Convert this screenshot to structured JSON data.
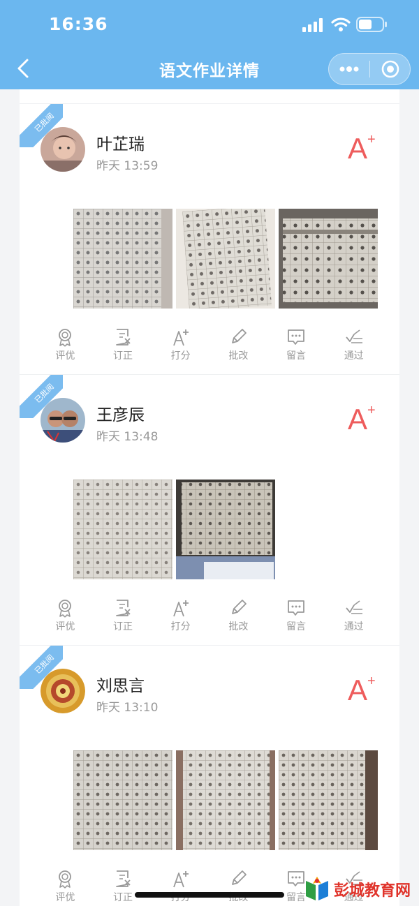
{
  "status": {
    "time": "16:36"
  },
  "nav": {
    "title": "语文作业详情"
  },
  "actions_labels": [
    "评优",
    "订正",
    "打分",
    "批改",
    "留言",
    "通过"
  ],
  "colors": {
    "header": "#6bb7ef",
    "grade": "#ee5c5c",
    "ribbon": "#7bbcef"
  },
  "submissions": [
    {
      "ribbon": "已批阅",
      "name": "叶芷瑞",
      "time": "昨天 13:59",
      "grade": "A",
      "grade_sup": "+",
      "photo_count": 3
    },
    {
      "ribbon": "已批阅",
      "name": "王彦辰",
      "time": "昨天 13:48",
      "grade": "A",
      "grade_sup": "+",
      "photo_count": 2
    },
    {
      "ribbon": "已批阅",
      "name": "刘思言",
      "time": "昨天 13:10",
      "grade": "A",
      "grade_sup": "+",
      "photo_count": 3
    }
  ],
  "watermark": {
    "text": "彭城教育网"
  }
}
